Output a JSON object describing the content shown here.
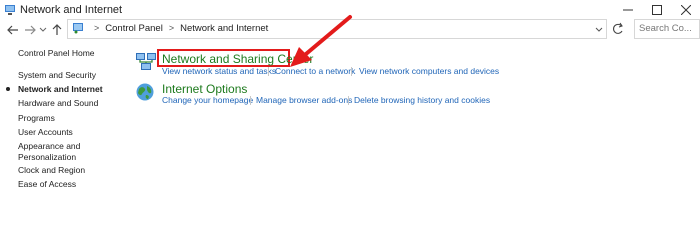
{
  "window": {
    "title": "Network and Internet",
    "controls": [
      "minimize",
      "maximize",
      "close"
    ]
  },
  "nav": {
    "icons": [
      "back-arrow-icon",
      "forward-arrow-icon",
      "recent-dropdown-icon",
      "up-arrow-icon"
    ]
  },
  "address": {
    "breadcrumbs": [
      "Control Panel",
      "Network and Internet"
    ],
    "separator": ">"
  },
  "search": {
    "placeholder": "Search Co..."
  },
  "sidebar": {
    "items": [
      {
        "label": "Control Panel Home"
      },
      {
        "label": "System and Security"
      },
      {
        "label": "Network and Internet",
        "current": true
      },
      {
        "label": "Hardware and Sound"
      },
      {
        "label": "Programs"
      },
      {
        "label": "User Accounts"
      },
      {
        "label": "Appearance and"
      },
      {
        "label": "Personalization"
      },
      {
        "label": "Clock and Region"
      },
      {
        "label": "Ease of Access"
      }
    ]
  },
  "categories": [
    {
      "title": "Network and Sharing Center",
      "icon": "network-sharing-icon",
      "links": [
        "View network status and tasks",
        "Connect to a network",
        "View network computers and devices"
      ]
    },
    {
      "title": "Internet Options",
      "icon": "internet-options-globe-icon",
      "links": [
        "Change your homepage",
        "Manage browser add-ons",
        "Delete browsing history and cookies"
      ]
    }
  ],
  "annotation": {
    "highlight_color": "#e31b1b",
    "arrow_color": "#e31b1b"
  },
  "colors": {
    "category_title": "#1d7a1d",
    "link": "#2166b8"
  }
}
